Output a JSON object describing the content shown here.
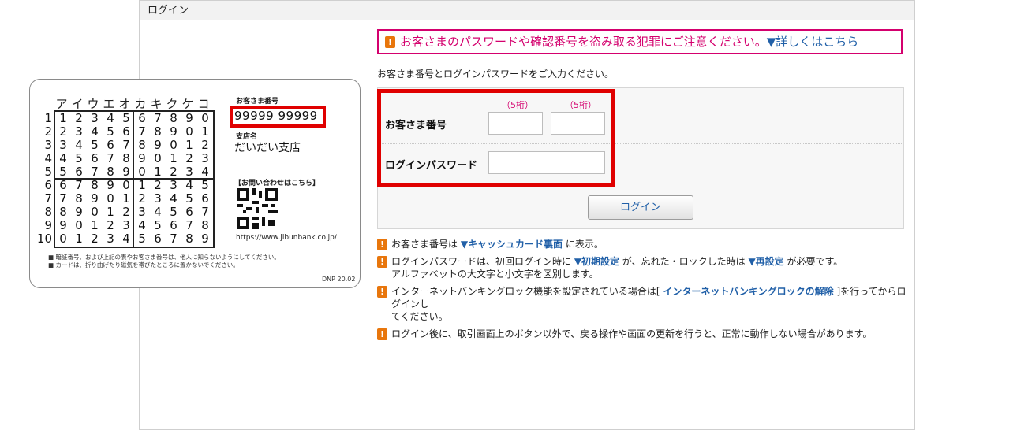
{
  "panel": {
    "title": "ログイン"
  },
  "banner": {
    "text": "お客さまのパスワードや確認番号を盗み取る犯罪にご注意ください。",
    "link": "▼詳しくはこちら"
  },
  "intro": "お客さま番号とログインパスワードをご入力ください。",
  "form": {
    "customer_number_label": "お客さま番号",
    "digits_hint": "（5桁）",
    "password_label": "ログインパスワード",
    "login_button": "ログイン"
  },
  "notes": [
    {
      "pre": "お客さま番号は ",
      "link": "▼キャッシュカード裏面",
      "post": " に表示。"
    },
    {
      "pre": "ログインパスワードは、初回ログイン時に ",
      "link": "▼初期設定",
      "mid": " が、忘れた・ロックした時は ",
      "link2": "▼再設定",
      "post": " が必要です。",
      "line2": "アルファベットの大文字と小文字を区別します。"
    },
    {
      "pre": "インターネットバンキングロック機能を設定されている場合は[ ",
      "link": "インターネットバンキングロックの解除",
      "post": " ]を行ってからログインし",
      "line2": "てください。"
    },
    {
      "pre": "ログイン後に、取引画面上のボタン以外で、戻る操作や画面の更新を行うと、正常に動作しない場合があります。"
    }
  ],
  "card": {
    "header_kana": [
      "ア",
      "イ",
      "ウ",
      "エ",
      "オ",
      "カ",
      "キ",
      "ク",
      "ケ",
      "コ"
    ],
    "rows": [
      [
        "1",
        "2",
        "3",
        "4",
        "5",
        "6",
        "7",
        "8",
        "9",
        "0"
      ],
      [
        "2",
        "3",
        "4",
        "5",
        "6",
        "7",
        "8",
        "9",
        "0",
        "1"
      ],
      [
        "3",
        "4",
        "5",
        "6",
        "7",
        "8",
        "9",
        "0",
        "1",
        "2"
      ],
      [
        "4",
        "5",
        "6",
        "7",
        "8",
        "9",
        "0",
        "1",
        "2",
        "3"
      ],
      [
        "5",
        "6",
        "7",
        "8",
        "9",
        "0",
        "1",
        "2",
        "3",
        "4"
      ],
      [
        "6",
        "7",
        "8",
        "9",
        "0",
        "1",
        "2",
        "3",
        "4",
        "5"
      ],
      [
        "7",
        "8",
        "9",
        "0",
        "1",
        "2",
        "3",
        "4",
        "5",
        "6"
      ],
      [
        "8",
        "9",
        "0",
        "1",
        "2",
        "3",
        "4",
        "5",
        "6",
        "7"
      ],
      [
        "9",
        "0",
        "1",
        "2",
        "3",
        "4",
        "5",
        "6",
        "7",
        "8"
      ],
      [
        "0",
        "1",
        "2",
        "3",
        "4",
        "5",
        "6",
        "7",
        "8",
        "9"
      ]
    ],
    "row_numbers": [
      "1",
      "2",
      "3",
      "4",
      "5",
      "6",
      "7",
      "8",
      "9",
      "10"
    ],
    "customer_number_label": "お客さま番号",
    "customer_number": "99999 99999",
    "branch_label": "支店名",
    "branch_name": "だいだい支店",
    "contact_label": "【お問い合わせはこちら】",
    "url": "https://www.jibunbank.co.jp/",
    "note1": "■ 暗証番号、および上記の表やお客さま番号は、他人に知らないようにしてください。",
    "note2": "■ カードは、折り曲げたり磁気を帯びたところに置かないでください。",
    "code": "DNP 20.02"
  }
}
